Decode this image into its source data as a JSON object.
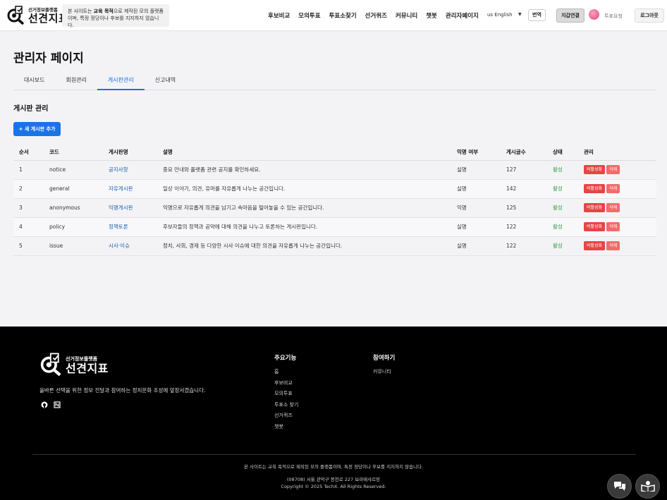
{
  "header": {
    "logo_sub": "선거정보플랫폼",
    "logo_main": "선견지표",
    "notice_prefix": "본 사이트는 ",
    "notice_bold": "교육 목적",
    "notice_rest": "으로 제작된 모의 플랫폼",
    "notice_line2": "이며, 특정 정당이나 후보를 지지하지 않습니다.",
    "nav": [
      "후보비교",
      "모의투표",
      "투표소찾기",
      "선거퀴즈",
      "커뮤니티",
      "챗봇",
      "관리자페이지"
    ],
    "language": "us English",
    "translate_label": "번역",
    "wallet_label": "지갑연결",
    "vote_request": "투표요청",
    "logout_label": "로그아웃"
  },
  "main": {
    "page_title": "관리자 페이지",
    "tabs": [
      "대시보드",
      "회원관리",
      "게시판관리",
      "신고내역"
    ],
    "active_tab": "게시판관리",
    "section_title": "게시판 관리",
    "add_button": "+ 새 게시판 추가",
    "table": {
      "headers": [
        "순서",
        "코드",
        "게시판명",
        "설명",
        "익명 여부",
        "게시글수",
        "상태",
        "관리"
      ],
      "rows": [
        {
          "order": "1",
          "code": "notice",
          "name": "공지사항",
          "desc": "중요 안내와 플랫폼 관련 공지를 확인하세요.",
          "anon": "실명",
          "count": "127",
          "status": "활성"
        },
        {
          "order": "2",
          "code": "general",
          "name": "자유게시판",
          "desc": "일상 이야기, 의견, 유머를 자유롭게 나누는 공간입니다.",
          "anon": "실명",
          "count": "142",
          "status": "활성"
        },
        {
          "order": "3",
          "code": "anonymous",
          "name": "익명게시판",
          "desc": "익명으로 자유롭게 의견을 남기고 속마음을 털어놓을 수 있는 공간입니다.",
          "anon": "익명",
          "count": "125",
          "status": "활성"
        },
        {
          "order": "4",
          "code": "policy",
          "name": "정책토론",
          "desc": "후보자들의 정책과 공약에 대해 의견을 나누고 토론하는 게시판입니다.",
          "anon": "실명",
          "count": "122",
          "status": "활성"
        },
        {
          "order": "5",
          "code": "issue",
          "name": "시사·이슈",
          "desc": "정치, 사회, 경제 등 다양한 시사 이슈에 대한 의견을 자유롭게 나누는 공간입니다.",
          "anon": "실명",
          "count": "122",
          "status": "활성"
        }
      ],
      "deactivate_label": "비활성화",
      "delete_label": "삭제"
    }
  },
  "footer": {
    "logo_sub": "선거정보플랫폼",
    "logo_main": "선견지표",
    "description": "올바른 선택을 위한 정보 전달과 참여하는 정치문화 조성에 앞장서겠습니다.",
    "col1_title": "주요기능",
    "col1_items": [
      "홈",
      "후보비교",
      "모의투표",
      "투표소 찾기",
      "선거퀴즈",
      "챗봇"
    ],
    "col2_title": "참여하기",
    "col2_items": [
      "커뮤니티"
    ],
    "disclaimer": "본 사이트는 교육 목적으로 제작된 모의 플랫폼이며, 특정 정당이나 후보를 지지하지 않습니다.",
    "address": "(08708) 서울 관악구 봉천로 227 보라매샤르망",
    "copyright": "Copyright © 2025 TechX. All Rights Reserved."
  },
  "colors": {
    "accent": "#1a73e8",
    "active_status": "#2e9e42",
    "danger": "#e64545"
  }
}
